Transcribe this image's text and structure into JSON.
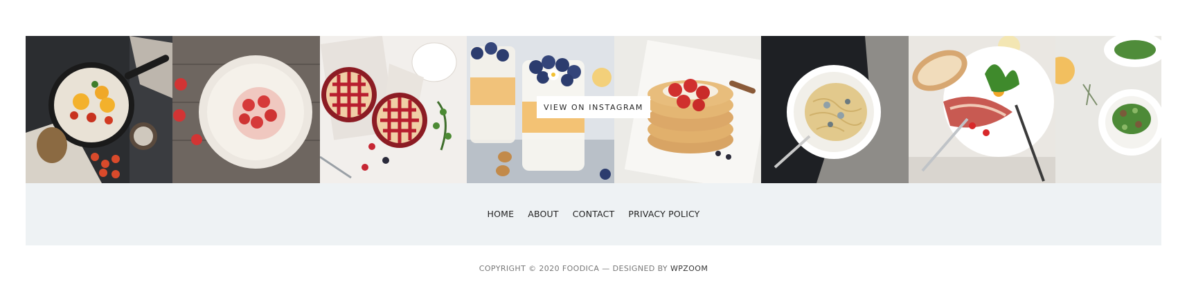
{
  "instagram": {
    "button_label": "VIEW ON INSTAGRAM",
    "tiles": [
      {
        "subject": "skillet-eggs-photo"
      },
      {
        "subject": "strawberry-tart-photo"
      },
      {
        "subject": "lattice-pies-photo"
      },
      {
        "subject": "blueberry-parfait-photo"
      },
      {
        "subject": "pancake-stack-photo"
      },
      {
        "subject": "pasta-plate-photo"
      },
      {
        "subject": "bacon-egg-toast-photo"
      },
      {
        "subject": "green-salad-photo"
      }
    ]
  },
  "footer_menu": {
    "items": [
      {
        "label": "HOME"
      },
      {
        "label": "ABOUT"
      },
      {
        "label": "CONTACT"
      },
      {
        "label": "PRIVACY POLICY"
      }
    ]
  },
  "copyright": {
    "text": "COPYRIGHT © 2020 FOODICA",
    "separator": "—",
    "designed_by_label": "DESIGNED BY",
    "designer_link": "WPZOOM"
  },
  "colors": {
    "footer_bg": "#eef2f4",
    "text_dark": "#222222",
    "text_muted": "#777777"
  }
}
